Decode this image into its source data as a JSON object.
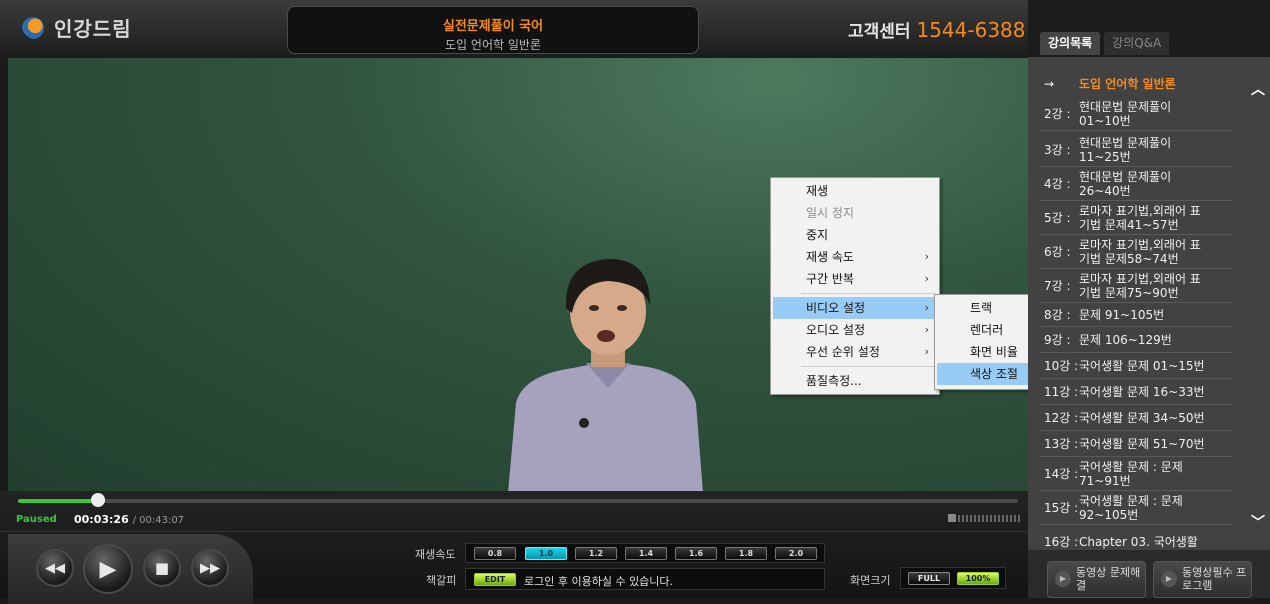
{
  "header": {
    "logo_text": "인강드림",
    "course_title": "실전문제풀이 국어",
    "lesson_title": "도입 언어학 일반론",
    "cs_label": "고객센터",
    "cs_number": "1544-6388"
  },
  "player": {
    "status": "Paused",
    "time_current": "00:03:26",
    "time_total": "/ 00:43:07",
    "progress": 0.08,
    "speed_label": "재생속도",
    "speeds": [
      "0.8",
      "1.0",
      "1.2",
      "1.4",
      "1.6",
      "1.8",
      "2.0"
    ],
    "speed_selected": "1.0",
    "bookmark_label": "책갈피",
    "bookmark_btn": "EDIT",
    "bookmark_msg": "로그인 후 이용하실 수 있습니다.",
    "screen_label": "화면크기",
    "screen_full": "FULL",
    "screen_100": "100%"
  },
  "context_menu": {
    "items": [
      "재생",
      "일시 정지",
      "중지",
      "재생 속도",
      "구간 반복",
      "비디오 설정",
      "오디오 설정",
      "우선 순위 설정",
      "품질측정..."
    ],
    "submenu": [
      "트랙",
      "렌더러",
      "화면 비율",
      "색상 조절"
    ]
  },
  "sidebar": {
    "tabs": [
      "강의목록",
      "강의Q&A"
    ],
    "lectures": [
      {
        "no": "→",
        "title": "도입 언어학 일반론"
      },
      {
        "no": "2강 :",
        "title": "현대문법 문제풀이 01~10번"
      },
      {
        "no": "3강 :",
        "title": "현대문법 문제풀이 11~25번"
      },
      {
        "no": "4강 :",
        "title": "현대문법 문제풀이 26~40번"
      },
      {
        "no": "5강 :",
        "title": "로마자 표기법,외래어 표기법 문제41~57번"
      },
      {
        "no": "6강 :",
        "title": "로마자 표기법,외래어 표기법 문제58~74번"
      },
      {
        "no": "7강 :",
        "title": "로마자 표기법,외래어 표기법 문제75~90번"
      },
      {
        "no": "8강 :",
        "title": "문제 91~105번"
      },
      {
        "no": "9강 :",
        "title": "문제 106~129번"
      },
      {
        "no": "10강 :",
        "title": "국어생활 문제 01~15번"
      },
      {
        "no": "11강 :",
        "title": "국어생활 문제 16~33번"
      },
      {
        "no": "12강 :",
        "title": "국어생활 문제 34~50번"
      },
      {
        "no": "13강 :",
        "title": "국어생활 문제 51~70번"
      },
      {
        "no": "14강 :",
        "title": "국어생활 문제 : 문제 71~91번"
      },
      {
        "no": "15강 :",
        "title": "국어생활 문제 : 문제 92~105번"
      },
      {
        "no": "16강 :",
        "title": "Chapter 03. 국어생활 문"
      }
    ],
    "btn1": "동영상 문제해결",
    "btn2": "동영상필수 프로그램"
  }
}
